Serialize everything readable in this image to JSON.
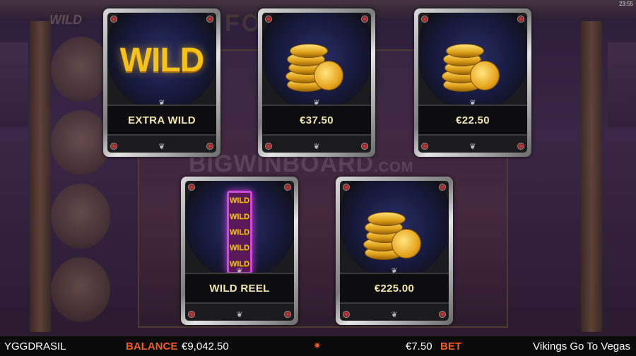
{
  "cards": [
    {
      "id": "extra-wild",
      "label": "EXTRA WILD",
      "icon": "wild-symbol",
      "symbol_text": "WILD"
    },
    {
      "id": "coins-1",
      "label": "€37.50",
      "icon": "gold-coins"
    },
    {
      "id": "coins-2",
      "label": "€22.50",
      "icon": "gold-coins"
    },
    {
      "id": "wild-reel",
      "label": "WILD REEL",
      "icon": "wild-reel-symbol",
      "reel_symbols": [
        "WILD",
        "WILD",
        "WILD",
        "WILD",
        "WILD"
      ]
    },
    {
      "id": "coins-3",
      "label": "€225.00",
      "icon": "gold-coins"
    }
  ],
  "status_bar": {
    "brand": "YGGDRASIL",
    "balance_label": "BALANCE",
    "balance_value": "€9,042.50",
    "bet_value": "€7.50",
    "bet_label": "BET",
    "game_name": "Vikings Go To Vegas"
  },
  "clock": "23:55",
  "watermark": {
    "main": "BIGWINBOARD",
    "suffix": ".COM"
  },
  "colors": {
    "accent": "#f05a2a",
    "gold": "#f6c21a",
    "card_label": "#f2e5b0"
  }
}
